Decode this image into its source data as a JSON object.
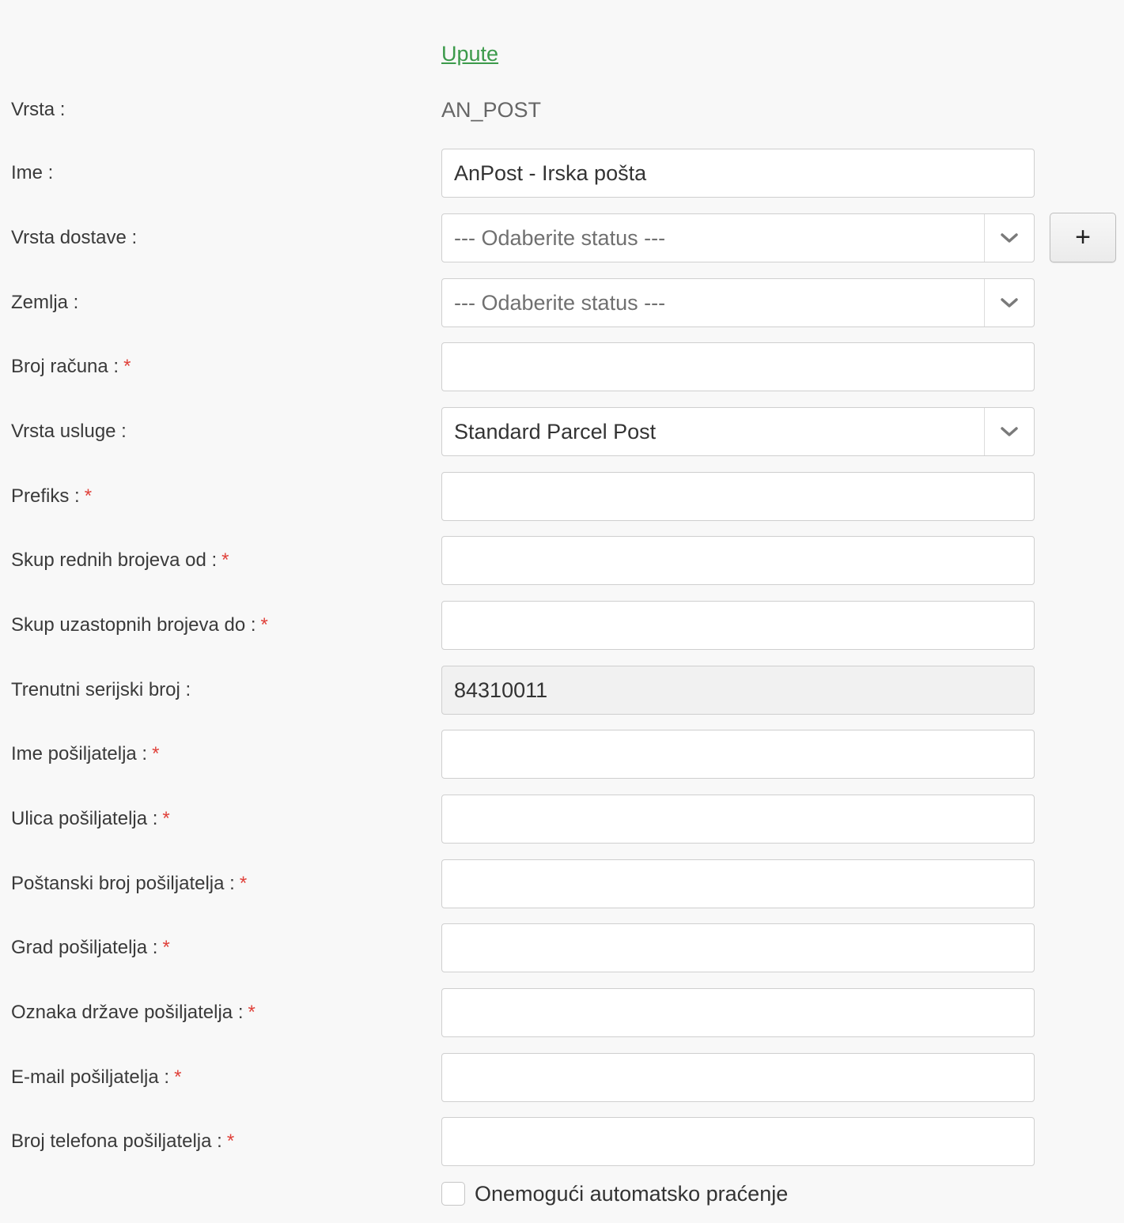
{
  "instructions_link": "Upute",
  "form": {
    "type": {
      "label": "Vrsta :",
      "value": "AN_POST"
    },
    "name": {
      "label": "Ime :",
      "value": "AnPost - Irska pošta"
    },
    "delivery_type": {
      "label": "Vrsta dostave :",
      "value": "--- Odaberite status ---",
      "add_button": "+"
    },
    "country": {
      "label": "Zemlja :",
      "value": "--- Odaberite status ---"
    },
    "account_number": {
      "label": "Broj računa :",
      "value": ""
    },
    "service_type": {
      "label": "Vrsta usluge :",
      "value": "Standard Parcel Post"
    },
    "prefix": {
      "label": "Prefiks :",
      "value": ""
    },
    "serial_from": {
      "label": "Skup rednih brojeva od :",
      "value": ""
    },
    "serial_to": {
      "label": "Skup uzastopnih brojeva do :",
      "value": ""
    },
    "current_serial": {
      "label": "Trenutni serijski broj :",
      "value": "84310011"
    },
    "sender_name": {
      "label": "Ime pošiljatelja :",
      "value": ""
    },
    "sender_street": {
      "label": "Ulica pošiljatelja :",
      "value": ""
    },
    "sender_postcode": {
      "label": "Poštanski broj pošiljatelja :",
      "value": ""
    },
    "sender_city": {
      "label": "Grad pošiljatelja :",
      "value": ""
    },
    "sender_country_code": {
      "label": "Oznaka države pošiljatelja :",
      "value": ""
    },
    "sender_email": {
      "label": "E-mail pošiljatelja :",
      "value": ""
    },
    "sender_phone": {
      "label": "Broj telefona pošiljatelja :",
      "value": ""
    },
    "disable_tracking": {
      "label": "Onemogući automatsko praćenje",
      "checked": false
    }
  },
  "required_marker": "*",
  "icons": {
    "select_arrow": "chevron-down-icon"
  },
  "colors": {
    "link": "#3c9a4b",
    "required": "#e0413a",
    "background": "#f8f8f8",
    "readonly_field": "#f1f1f1"
  }
}
